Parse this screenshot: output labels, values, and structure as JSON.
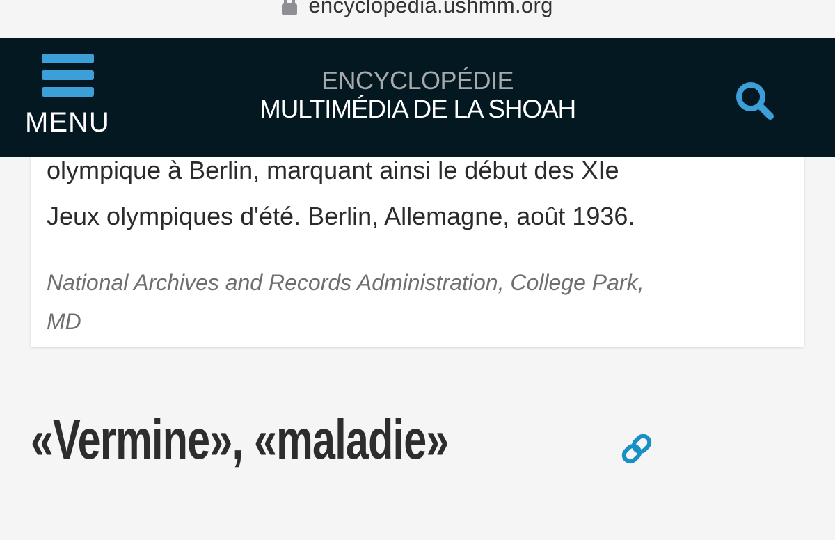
{
  "browser": {
    "url": "encyclopedia.ushmm.org",
    "lock_icon": "lock-icon"
  },
  "header": {
    "menu_label": "MENU",
    "menu_icon": "hamburger-icon",
    "logo_line1": "ENCYCLOPÉDIE",
    "logo_line2": "MULTIMÉDIA DE LA SHOAH",
    "search_icon": "search-icon",
    "colors": {
      "background": "#031821",
      "accent": "#3d9fd8",
      "logo_gray": "#a7a9ab"
    }
  },
  "caption_card": {
    "line1": "olympique à Berlin, marquant ainsi le début des XIe",
    "line2": "Jeux olympiques d'été. Berlin, Allemagne, août 1936.",
    "credit_line1": "National Archives and Records Administration, College Park,",
    "credit_line2": "MD"
  },
  "section": {
    "heading": "«Vermine», «maladie»",
    "link_icon": "link-icon"
  }
}
